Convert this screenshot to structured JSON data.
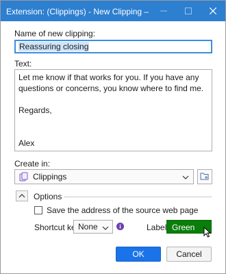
{
  "window": {
    "title": "Extension: (Clippings) - New Clipping — Mozilla F...",
    "titlebar_color": "#2d7fd0",
    "controls": [
      "minimize-icon",
      "maximize-icon",
      "close-icon"
    ]
  },
  "form": {
    "name_label": "Name of new clipping:",
    "name_value": "Reassuring closing",
    "text_label": "Text:",
    "text_value": "Let me know if that works for you. If you have any questions or concerns, you know where to find me.\n\nRegards,\n\n\nAlex",
    "create_in_label": "Create in:",
    "folder_value": "Clippings",
    "folder_icon": "clippings-folder-icon",
    "new_folder_icon": "new-folder-icon"
  },
  "options": {
    "section_label": "Options",
    "expanded": true,
    "save_source_label": "Save the address of the source web page",
    "save_source_checked": false,
    "shortcut_label": "Shortcut key:",
    "shortcut_value": "None",
    "label_label": "Label:",
    "label_value": "Green",
    "label_color": "#0a7d0a"
  },
  "buttons": {
    "ok": "OK",
    "cancel": "Cancel",
    "accent": "#1a73e8"
  }
}
